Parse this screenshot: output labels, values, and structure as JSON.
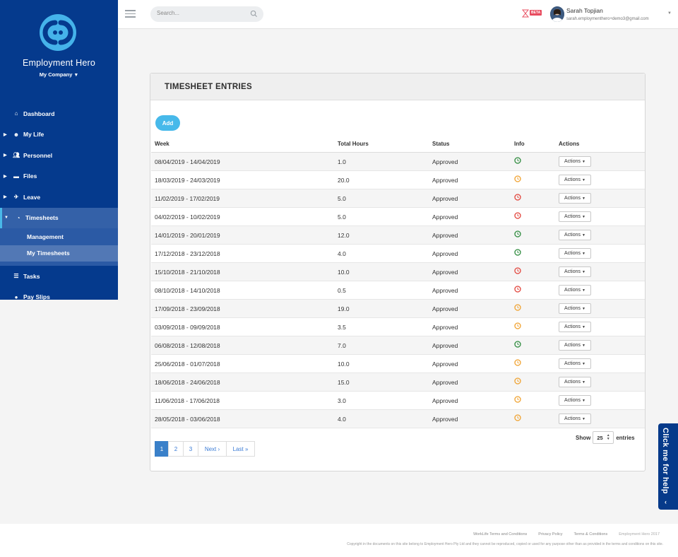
{
  "brand": {
    "name": "Employment Hero",
    "company": "My Company"
  },
  "sidebar": {
    "items": [
      {
        "label": "Dashboard",
        "icon": "home-icon"
      },
      {
        "label": "My Life",
        "icon": "smiley-icon"
      },
      {
        "label": "Personnel",
        "icon": "people-icon"
      },
      {
        "label": "Files",
        "icon": "folder-icon"
      },
      {
        "label": "Leave",
        "icon": "plane-icon"
      },
      {
        "label": "Timesheets",
        "icon": "clock-icon"
      },
      {
        "label": "Tasks",
        "icon": "list-icon"
      },
      {
        "label": "Pay Slips",
        "icon": "payslip-icon"
      }
    ],
    "sub_items": [
      {
        "label": "Management"
      },
      {
        "label": "My Timesheets"
      }
    ]
  },
  "header": {
    "search_placeholder": "Search...",
    "beta_label": "BETA",
    "user_name": "Sarah Topjian",
    "user_email": "sarah.employmenthero+demo3@gmail.com"
  },
  "card": {
    "title": "TIMESHEET ENTRIES",
    "add_label": "Add",
    "columns": [
      "Week",
      "Total Hours",
      "Status",
      "Info",
      "Actions"
    ]
  },
  "rows": [
    {
      "week": "08/04/2019 - 14/04/2019",
      "hours": "1.0",
      "status": "Approved",
      "info": "green",
      "action": "Actions"
    },
    {
      "week": "18/03/2019 - 24/03/2019",
      "hours": "20.0",
      "status": "Approved",
      "info": "orange",
      "action": "Actions"
    },
    {
      "week": "11/02/2019 - 17/02/2019",
      "hours": "5.0",
      "status": "Approved",
      "info": "red",
      "action": "Actions"
    },
    {
      "week": "04/02/2019 - 10/02/2019",
      "hours": "5.0",
      "status": "Approved",
      "info": "red",
      "action": "Actions"
    },
    {
      "week": "14/01/2019 - 20/01/2019",
      "hours": "12.0",
      "status": "Approved",
      "info": "green",
      "action": "Actions"
    },
    {
      "week": "17/12/2018 - 23/12/2018",
      "hours": "4.0",
      "status": "Approved",
      "info": "green",
      "action": "Actions"
    },
    {
      "week": "15/10/2018 - 21/10/2018",
      "hours": "10.0",
      "status": "Approved",
      "info": "red",
      "action": "Actions"
    },
    {
      "week": "08/10/2018 - 14/10/2018",
      "hours": "0.5",
      "status": "Approved",
      "info": "red",
      "action": "Actions"
    },
    {
      "week": "17/09/2018 - 23/09/2018",
      "hours": "19.0",
      "status": "Approved",
      "info": "orange",
      "action": "Actions"
    },
    {
      "week": "03/09/2018 - 09/09/2018",
      "hours": "3.5",
      "status": "Approved",
      "info": "orange",
      "action": "Actions"
    },
    {
      "week": "06/08/2018 - 12/08/2018",
      "hours": "7.0",
      "status": "Approved",
      "info": "green",
      "action": "Actions"
    },
    {
      "week": "25/06/2018 - 01/07/2018",
      "hours": "10.0",
      "status": "Approved",
      "info": "orange",
      "action": "Actions"
    },
    {
      "week": "18/06/2018 - 24/06/2018",
      "hours": "15.0",
      "status": "Approved",
      "info": "orange",
      "action": "Actions"
    },
    {
      "week": "11/06/2018 - 17/06/2018",
      "hours": "3.0",
      "status": "Approved",
      "info": "orange",
      "action": "Actions"
    },
    {
      "week": "28/05/2018 - 03/06/2018",
      "hours": "4.0",
      "status": "Approved",
      "info": "orange",
      "action": "Actions"
    }
  ],
  "info_colors": {
    "green": "#2e8b3e",
    "orange": "#f0a230",
    "red": "#e2443b"
  },
  "pagination": {
    "pages": [
      "1",
      "2",
      "3"
    ],
    "current": "1",
    "next": "Next ›",
    "last": "Last »"
  },
  "entries": {
    "show": "Show",
    "value": "25",
    "suffix": "entries"
  },
  "help": {
    "label": "Click me for help"
  },
  "footer": {
    "links": [
      "WorkLife Terms and Conditions",
      "Privacy Policy",
      "Terms & Conditions"
    ],
    "copyright": "Employment Hero 2017",
    "note": "Copyright in the documents on this site belong to Employment Hero Pty Ltd and they cannot be reproduced, copied or used for any purpose other than as provided in the terms and conditions on this site."
  },
  "colors": {
    "sidebar": "#053a8d",
    "accent": "#47b9ea",
    "pager_active": "#3a80c9"
  }
}
